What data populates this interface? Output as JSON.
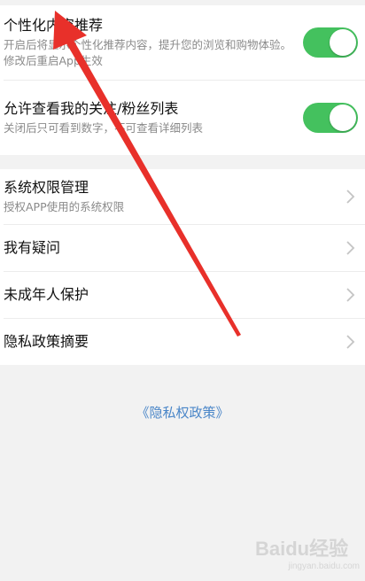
{
  "settings": {
    "personalized": {
      "title": "个性化内容推荐",
      "desc": "开启后将显示个性化推荐内容，提升您的浏览和购物体验。修改后重启App生效",
      "enabled": true
    },
    "follow_list": {
      "title": "允许查看我的关注/粉丝列表",
      "desc": "关闭后只可看到数字，不可查看详细列表",
      "enabled": true
    }
  },
  "nav": {
    "permissions": {
      "title": "系统权限管理",
      "desc": "授权APP使用的系统权限"
    },
    "questions": {
      "title": "我有疑问"
    },
    "minor": {
      "title": "未成年人保护"
    },
    "privacy_summary": {
      "title": "隐私政策摘要"
    }
  },
  "privacy_policy_link": "《隐私权政策》",
  "watermark": {
    "brand": "Baidu经验",
    "url": "jingyan.baidu.com"
  },
  "colors": {
    "toggle_on": "#44c15e",
    "link": "#4a86c8",
    "annotation_arrow": "#e8302a"
  }
}
